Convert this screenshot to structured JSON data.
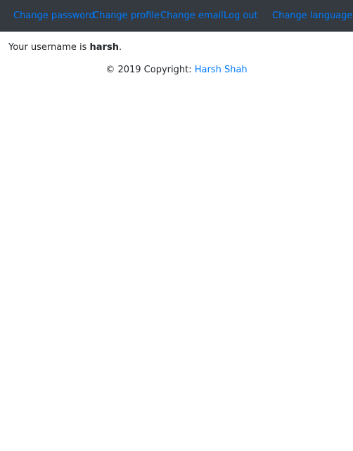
{
  "navbar": {
    "background": "#343a40",
    "link_color": "#007bff",
    "links": [
      {
        "label": "Change password"
      },
      {
        "label": "Change profile"
      },
      {
        "label": "Change email"
      },
      {
        "label": "Log out"
      },
      {
        "label": "Change language"
      }
    ]
  },
  "main": {
    "prefix": "Your username is ",
    "username": "harsh",
    "suffix": "."
  },
  "footer": {
    "text": "© 2019 Copyright: ",
    "link_label": "Harsh Shah"
  }
}
